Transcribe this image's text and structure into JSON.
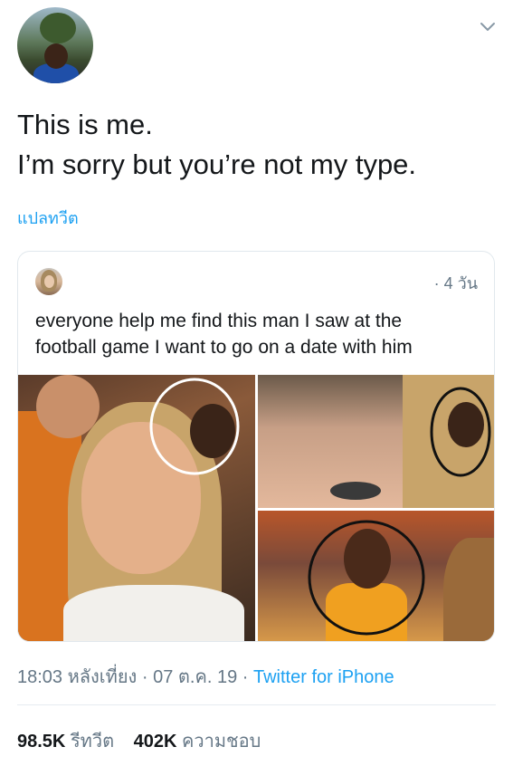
{
  "tweet": {
    "lines": [
      "This is me.",
      "I’m sorry but you’re not my type."
    ],
    "translate_label": "แปลทวีต"
  },
  "quoted": {
    "time": "· 4 วัน",
    "lines": [
      "everyone help me find this man I saw at the",
      "football game I want to go on a date with him"
    ]
  },
  "meta": {
    "time": "18:03 หลังเที่ยง",
    "date": "07 ต.ค. 19",
    "source": "Twitter for iPhone"
  },
  "stats": {
    "retweets_count": "98.5K",
    "retweets_label": "รีทวีต",
    "likes_count": "402K",
    "likes_label": "ความชอบ"
  },
  "icons": {
    "menu": "chevron-down-icon"
  },
  "colors": {
    "link": "#1da1f2",
    "secondary": "#657786",
    "text": "#14171a"
  }
}
